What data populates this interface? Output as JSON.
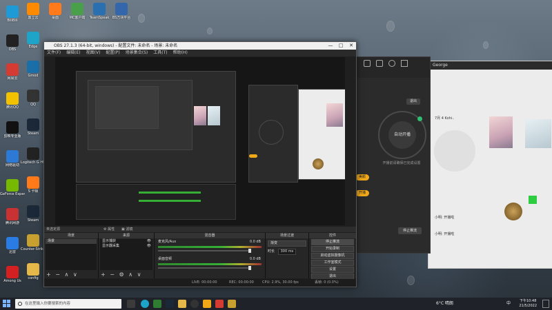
{
  "desktop": {
    "icons_col1": [
      {
        "label": "BiliBili",
        "color": "#1e9bd6"
      },
      {
        "label": "OBS",
        "color": "#222222"
      },
      {
        "label": "网易云",
        "color": "#d43c33"
      },
      {
        "label": "腾讯QQ",
        "color": "#f2c200"
      },
      {
        "label": "剪映专业版",
        "color": "#111111"
      },
      {
        "label": "网络驱动",
        "color": "#2d7ad6"
      },
      {
        "label": "GeForce Experience",
        "color": "#76b900"
      },
      {
        "label": "腾讯网游",
        "color": "#c83232"
      },
      {
        "label": "迅雷",
        "color": "#2a7be4"
      },
      {
        "label": "Among Us",
        "color": "#d42020"
      }
    ],
    "icons_col2": [
      {
        "label": "鼎立云",
        "color": "#ff8a00"
      },
      {
        "label": "Edge",
        "color": "#1fa4c9"
      },
      {
        "label": "Gmod",
        "color": "#1b6fa8"
      },
      {
        "label": "QQ",
        "color": "#333333"
      },
      {
        "label": "Steam",
        "color": "#1b2838"
      },
      {
        "label": "Logitech G HUB",
        "color": "#222222"
      },
      {
        "label": "S 卡顿",
        "color": "#ff7b1a"
      },
      {
        "label": "Steam",
        "color": "#1b2838"
      },
      {
        "label": "Counter-Strike Global Off...",
        "color": "#c8a030"
      },
      {
        "label": "config",
        "color": "#e6b84a"
      }
    ],
    "top_icons": [
      {
        "label": "桌面",
        "color": "#ff7a1a"
      },
      {
        "label": "MC客户端",
        "color": "#4aa04a"
      },
      {
        "label": "TeamSpeak",
        "color": "#2a6fb0"
      },
      {
        "label": "BS方块平台",
        "color": "#3366aa"
      }
    ]
  },
  "obs": {
    "title": "OBS 27.1.3 (64-bit, windows) - 配置文件: 未命名 - 场景: 未命名",
    "minimize_label": "—",
    "maximize_label": "□",
    "close_label": "✕",
    "menu": [
      "文件(F)",
      "编辑(E)",
      "视图(V)",
      "配置(P)",
      "场景集合(S)",
      "工具(T)",
      "帮助(H)"
    ],
    "dock_bar": [
      "未选定源",
      "⚙ 属性",
      "▣ 滤镜"
    ],
    "scenes_header": "场景",
    "scenes": [
      "场景"
    ],
    "sources_header": "来源",
    "sources": [
      {
        "name": "显示捕获",
        "visible": true
      },
      {
        "name": "显示器采集",
        "visible": true
      }
    ],
    "mixer_header": "混音器",
    "mixer_tracks": [
      {
        "name": "麦克风/Aux",
        "level": "0.0 dB"
      },
      {
        "name": "桌面音频",
        "level": "0.0 dB"
      }
    ],
    "transitions_header": "场景过渡",
    "transition_type": "渐变",
    "duration_label": "时长",
    "duration_value": "300 ms",
    "controls_header": "控件",
    "controls": [
      "停止推流",
      "开始录制",
      "启动虚拟摄像机",
      "工作室模式",
      "设置",
      "退出"
    ],
    "status": {
      "live": "LIVE: 00:00:00",
      "rec": "REC: 00:00:00",
      "cpu": "CPU: 2.9%, 30.00 fps",
      "dropped": "丢帧: 0 (0.0%)"
    },
    "list_controls": "+ − ∧ ∨"
  },
  "app": {
    "circle_label": "自动开播",
    "sub_text": "开播前请确保已完成设置",
    "pills": [
      "美颜",
      "开播"
    ],
    "exit_label": "退出",
    "bottom_button": "停止推流"
  },
  "chat": {
    "title": "George",
    "messages": [
      "7月 4 Kohi..",
      "小明: 开播啦",
      "小明: 开播啦"
    ],
    "bottom_text": "小丑"
  },
  "taskbar": {
    "search_placeholder": "在这里输入你要搜索的内容",
    "weather": "6°C 晴朗",
    "lang": "中",
    "time": "下午10:48",
    "date": "21/5/2022"
  }
}
